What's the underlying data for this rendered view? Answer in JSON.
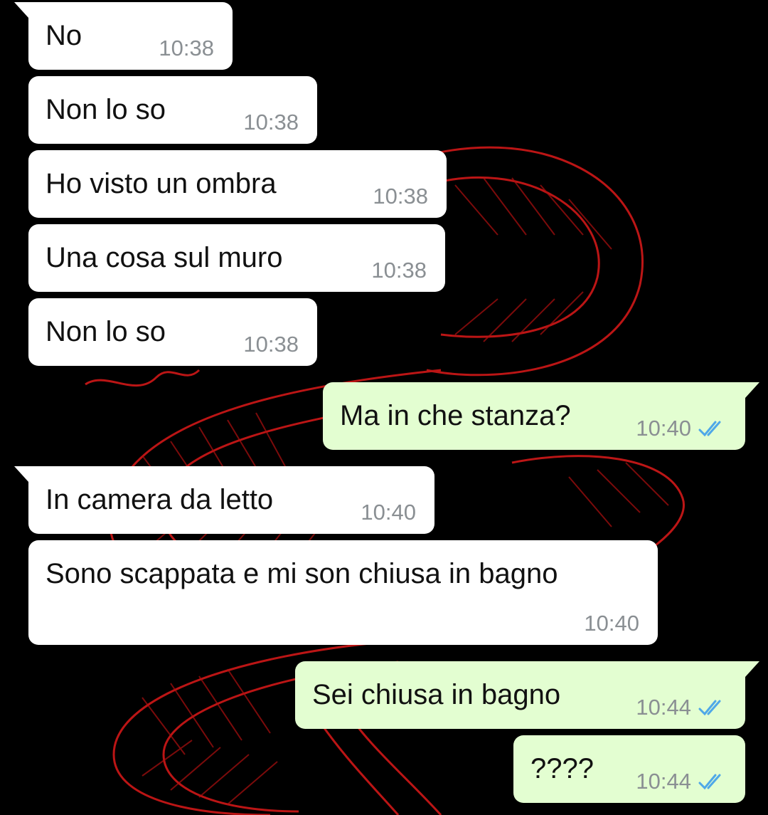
{
  "colors": {
    "incoming_bubble": "#ffffff",
    "outgoing_bubble": "#e3fed1",
    "read_ticks": "#4fa8e8",
    "wallpaper_background": "#000000",
    "wallpaper_pattern": "#d01818"
  },
  "wallpaper": {
    "description": "red-serpent-line-art"
  },
  "messages": [
    {
      "direction": "in",
      "text": "No",
      "time": "10:38"
    },
    {
      "direction": "in",
      "text": "Non lo so",
      "time": "10:38"
    },
    {
      "direction": "in",
      "text": "Ho visto un ombra",
      "time": "10:38"
    },
    {
      "direction": "in",
      "text": "Una cosa sul muro",
      "time": "10:38"
    },
    {
      "direction": "in",
      "text": "Non lo so",
      "time": "10:38"
    },
    {
      "direction": "out",
      "text": "Ma in che stanza?",
      "time": "10:40",
      "status": "read"
    },
    {
      "direction": "in",
      "text": "In camera da letto",
      "time": "10:40"
    },
    {
      "direction": "in",
      "text": "Sono scappata e mi son chiusa in bagno",
      "time": "10:40"
    },
    {
      "direction": "out",
      "text": "Sei chiusa in bagno",
      "time": "10:44",
      "status": "read"
    },
    {
      "direction": "out",
      "text": "????",
      "time": "10:44",
      "status": "read"
    }
  ]
}
